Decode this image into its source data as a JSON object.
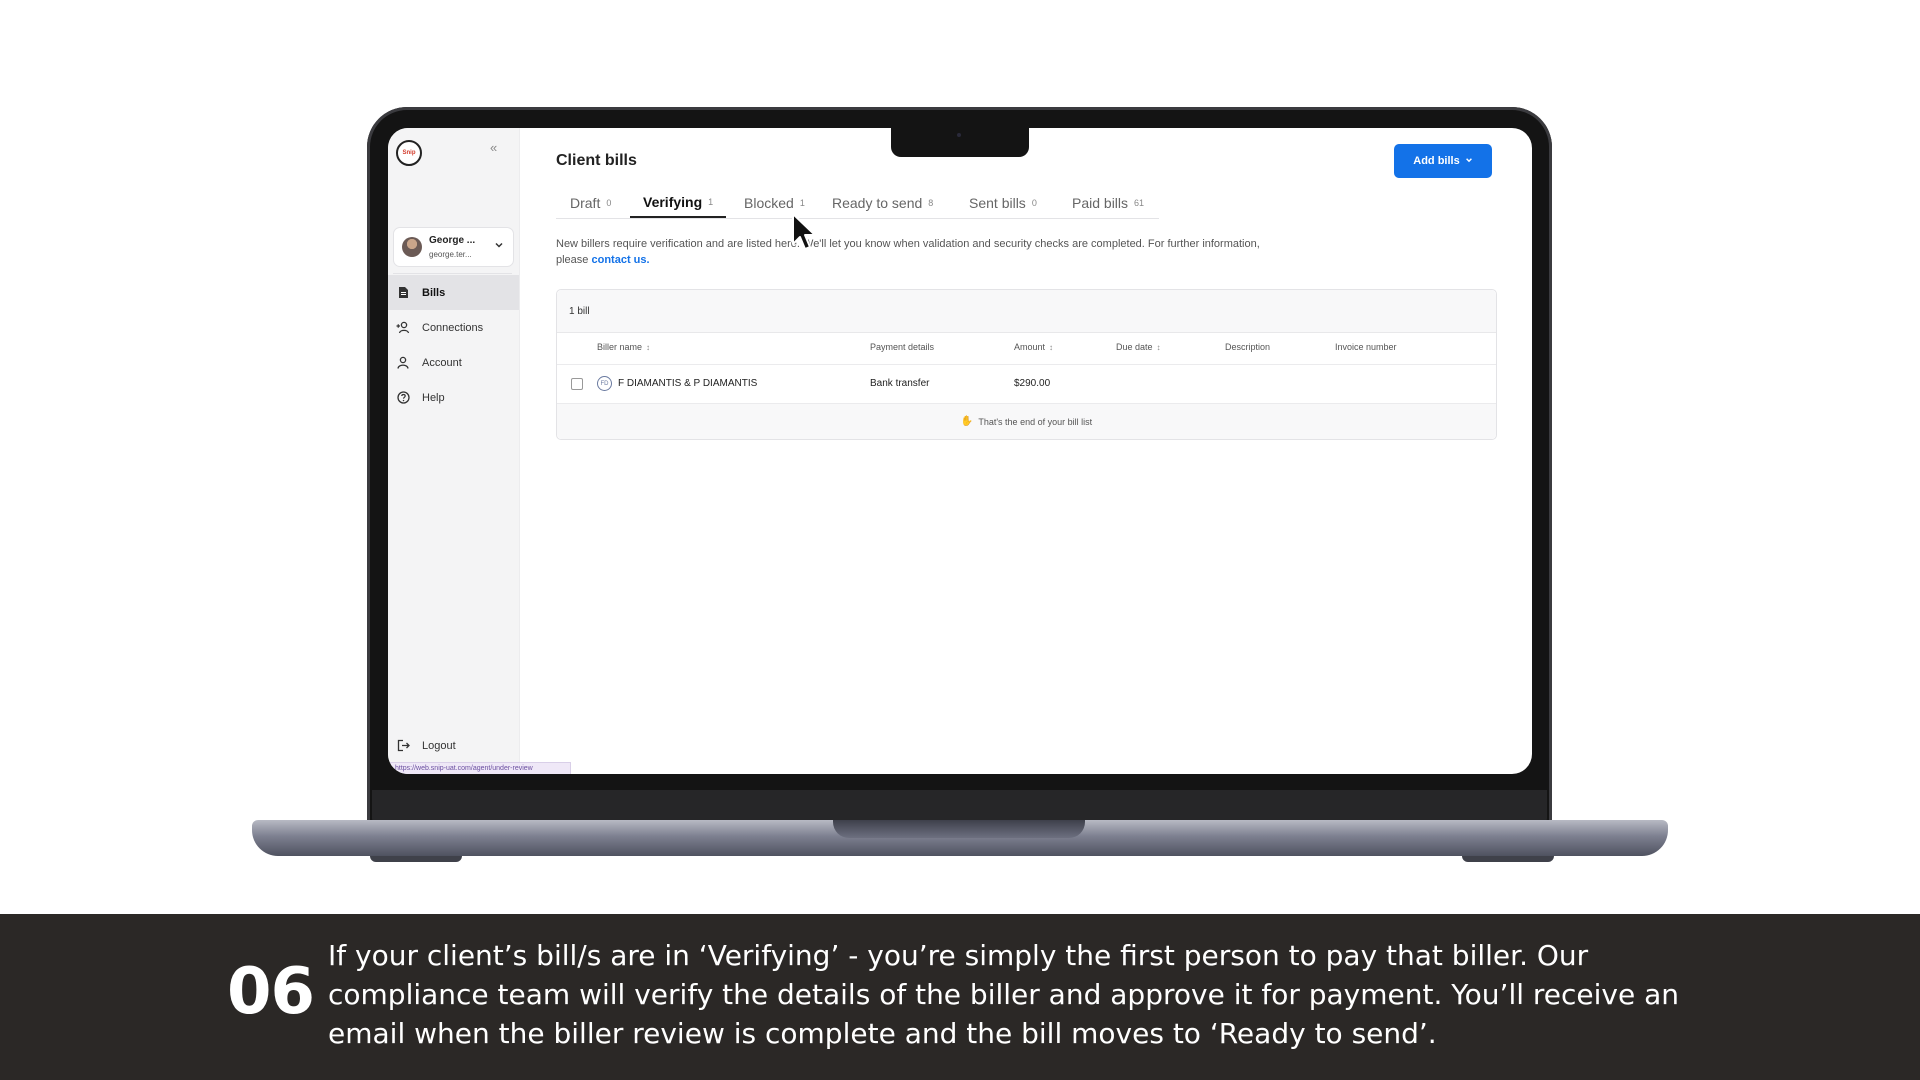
{
  "sidebar": {
    "logo_text": "Snip",
    "collapse_glyph": "«",
    "user": {
      "name": "George ...",
      "email": "george.ter..."
    },
    "items": [
      {
        "label": "Bills",
        "icon": "bill-icon",
        "active": true
      },
      {
        "label": "Connections",
        "icon": "connections-icon",
        "active": false
      },
      {
        "label": "Account",
        "icon": "user-icon",
        "active": false
      },
      {
        "label": "Help",
        "icon": "help-icon",
        "active": false
      }
    ],
    "logout_label": "Logout",
    "status_url": "https://web.snip-uat.com/agent/under-review"
  },
  "main": {
    "title": "Client bills",
    "add_button_label": "Add bills",
    "tabs": [
      {
        "label": "Draft",
        "count": "0",
        "active": false
      },
      {
        "label": "Verifying",
        "count": "1",
        "active": true
      },
      {
        "label": "Blocked",
        "count": "1",
        "active": false
      },
      {
        "label": "Ready to send",
        "count": "8",
        "active": false
      },
      {
        "label": "Sent bills",
        "count": "0",
        "active": false
      },
      {
        "label": "Paid bills",
        "count": "61",
        "active": false
      }
    ],
    "info_text": "New billers require verification and are listed here. We'll let you know when validation and security checks are completed. For further information, please",
    "info_link": "contact us.",
    "table": {
      "bill_count": "1 bill",
      "headers": {
        "biller_name": "Biller name",
        "payment_details": "Payment details",
        "amount": "Amount",
        "due_date": "Due date",
        "description": "Description",
        "invoice_number": "Invoice number"
      },
      "rows": [
        {
          "biller_name": "F DIAMANTIS & P DIAMANTIS",
          "biller_initials": "FD",
          "payment_details": "Bank transfer",
          "amount": "$290.00",
          "due_date": "",
          "description": "",
          "invoice_number": ""
        }
      ],
      "footer": "That's the end of your bill list"
    }
  },
  "caption": {
    "step": "06",
    "text": "If your client’s bill/s are in ‘Verifying’ - you’re simply the first person to pay that biller. Our compliance team will verify the details of the biller and approve it for payment. You’ll receive an email when the biller review is complete and the bill moves to ‘Ready to send’."
  },
  "colors": {
    "accent": "#1372e8",
    "caption_background": "#2b2826",
    "sidebar_background": "#f4f4f5"
  }
}
